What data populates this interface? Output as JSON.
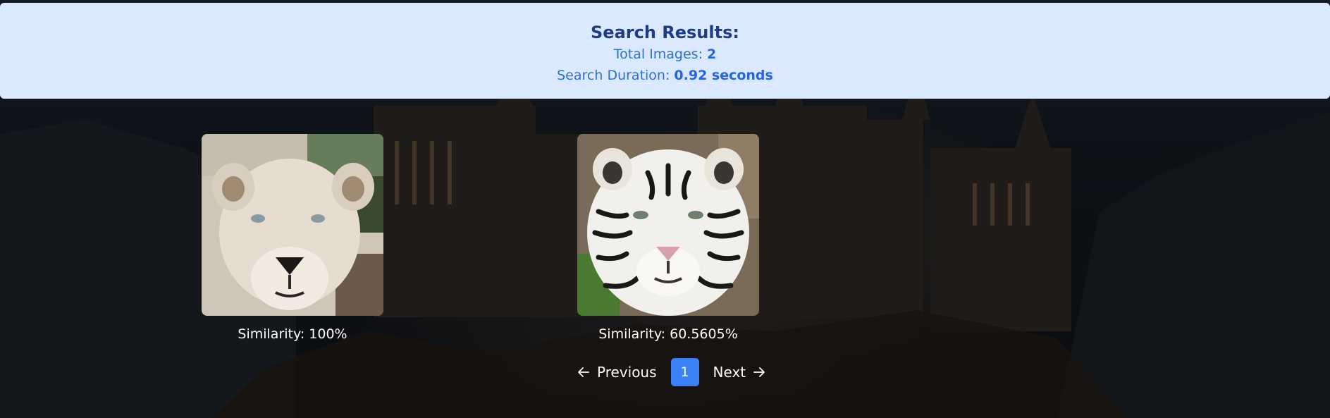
{
  "results": {
    "title": "Search Results:",
    "total_label": "Total Images: ",
    "total_value": "2",
    "duration_label": "Search Duration: ",
    "duration_value": "0.92 seconds"
  },
  "cards": [
    {
      "subject": "white lioness",
      "similarity": "Similarity: 100%"
    },
    {
      "subject": "white tiger",
      "similarity": "Similarity: 60.5605%"
    }
  ],
  "pagination": {
    "previous_label": "Previous",
    "current_page": "1",
    "next_label": "Next"
  },
  "colors": {
    "panel_bg": "#dbe9fe",
    "title": "#1e3a8a",
    "accent": "#3b82f6"
  },
  "icons": [
    "arrow-left-icon",
    "arrow-right-icon"
  ]
}
